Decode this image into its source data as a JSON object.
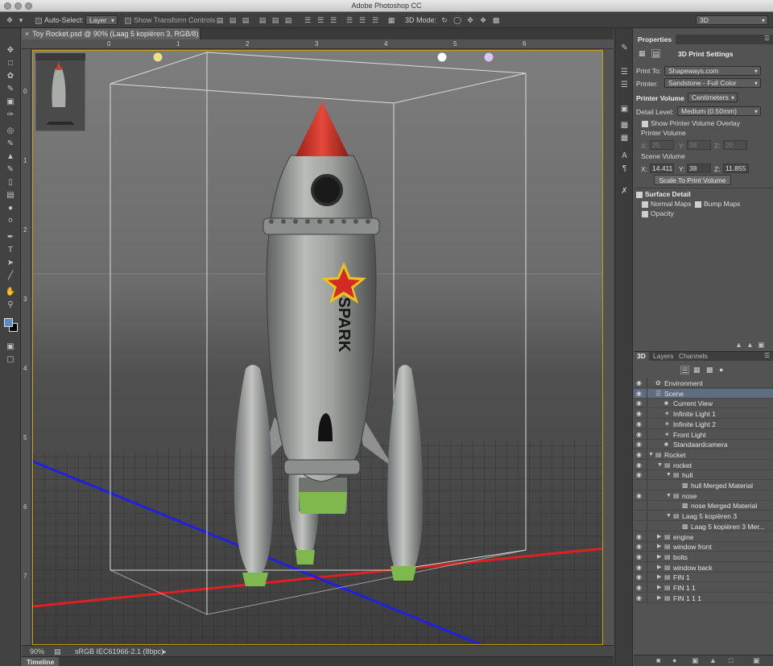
{
  "window": {
    "title": "Adobe Photoshop CC"
  },
  "options_bar": {
    "auto_select_label": "Auto-Select:",
    "auto_select_value": "Layer",
    "show_transform_label": "Show Transform Controls",
    "mode_3d_label": "3D Mode:",
    "workspace": "3D"
  },
  "document": {
    "tab_title": "Toy Rocket.psd @ 90% (Laag 5 kopiëren 3, RGB/8) *",
    "ruler_h": [
      "0",
      "1",
      "2",
      "3",
      "4",
      "5",
      "6"
    ],
    "ruler_v": [
      "0",
      "1",
      "2",
      "3",
      "4",
      "5",
      "6",
      "7"
    ],
    "rocket_label": "SPARK"
  },
  "status_bar": {
    "zoom": "90%",
    "profile": "sRGB IEC61966-2.1 (8bpc)"
  },
  "timeline": {
    "label": "Timeline"
  },
  "properties": {
    "panel_tab": "Properties",
    "section_title": "3D Print Settings",
    "print_to_label": "Print To:",
    "print_to_value": "Shapeways.com",
    "printer_label": "Printer:",
    "printer_value": "Sandstone - Full Color",
    "printer_volume_label": "Printer Volume",
    "unit_value": "Centimeters",
    "detail_level_label": "Detail Level:",
    "detail_level_value": "Medium (0.50mm)",
    "show_overlay_label": "Show Printer Volume Overlay",
    "printer_volume_sub_label": "Printer Volume",
    "printer_volume": {
      "x": "25",
      "y": "38",
      "z": "20"
    },
    "scene_volume_label": "Scene Volume",
    "scene_volume": {
      "x": "14.411",
      "y": "38",
      "z": "11.855"
    },
    "axis_labels": {
      "x": "X:",
      "y": "Y:",
      "z": "Z:"
    },
    "scale_button": "Scale To Print Volume",
    "surface_detail_label": "Surface Detail",
    "normal_maps_label": "Normal Maps",
    "bump_maps_label": "Bump Maps",
    "opacity_label": "Opacity"
  },
  "layers_panel": {
    "tabs": [
      "3D",
      "Layers",
      "Channels"
    ],
    "rows": [
      {
        "label": "Environment",
        "indent": 0,
        "icon": "environment",
        "twirl": false,
        "selected": false,
        "eye": true
      },
      {
        "label": "Scene",
        "indent": 0,
        "icon": "scene",
        "twirl": false,
        "selected": true,
        "eye": true
      },
      {
        "label": "Current View",
        "indent": 1,
        "icon": "camera",
        "twirl": false,
        "selected": false,
        "eye": true
      },
      {
        "label": "Infinite Light 1",
        "indent": 1,
        "icon": "light",
        "twirl": false,
        "selected": false,
        "eye": true
      },
      {
        "label": "Infinite Light 2",
        "indent": 1,
        "icon": "light",
        "twirl": false,
        "selected": false,
        "eye": true
      },
      {
        "label": "Front Light",
        "indent": 1,
        "icon": "light",
        "twirl": false,
        "selected": false,
        "eye": true
      },
      {
        "label": "Standaardcamera",
        "indent": 1,
        "icon": "camera",
        "twirl": false,
        "selected": false,
        "eye": true
      },
      {
        "label": "Rocket",
        "indent": 0,
        "icon": "folder",
        "twirl": "open",
        "selected": false,
        "eye": true
      },
      {
        "label": "rocket",
        "indent": 1,
        "icon": "folder",
        "twirl": "open",
        "selected": false,
        "eye": true
      },
      {
        "label": "hull",
        "indent": 2,
        "icon": "folder",
        "twirl": "open",
        "selected": false,
        "eye": true
      },
      {
        "label": "hull Merged Material",
        "indent": 3,
        "icon": "material",
        "twirl": false,
        "selected": false,
        "eye": false
      },
      {
        "label": "nose",
        "indent": 2,
        "icon": "folder",
        "twirl": "open",
        "selected": false,
        "eye": true
      },
      {
        "label": "nose Merged Material",
        "indent": 3,
        "icon": "material",
        "twirl": false,
        "selected": false,
        "eye": false
      },
      {
        "label": "Laag 5 kopiëren 3",
        "indent": 2,
        "icon": "folder",
        "twirl": "open",
        "selected": false,
        "eye": false
      },
      {
        "label": "Laag 5 kopiëren 3 Mer...",
        "indent": 3,
        "icon": "material",
        "twirl": false,
        "selected": false,
        "eye": false
      },
      {
        "label": "engine",
        "indent": 1,
        "icon": "folder",
        "twirl": "closed",
        "selected": false,
        "eye": true
      },
      {
        "label": "window front",
        "indent": 1,
        "icon": "folder",
        "twirl": "closed",
        "selected": false,
        "eye": true
      },
      {
        "label": "bolts",
        "indent": 1,
        "icon": "folder",
        "twirl": "closed",
        "selected": false,
        "eye": true
      },
      {
        "label": "window back",
        "indent": 1,
        "icon": "folder",
        "twirl": "closed",
        "selected": false,
        "eye": true
      },
      {
        "label": "FIN 1",
        "indent": 1,
        "icon": "folder",
        "twirl": "closed",
        "selected": false,
        "eye": true
      },
      {
        "label": "FIN 1 1",
        "indent": 1,
        "icon": "folder",
        "twirl": "closed",
        "selected": false,
        "eye": true
      },
      {
        "label": "FIN 1 1 1",
        "indent": 1,
        "icon": "folder",
        "twirl": "closed",
        "selected": false,
        "eye": true
      }
    ]
  },
  "colors": {
    "foreground": "#5a8cc8",
    "background": "#000000",
    "selection": "#5e6e80",
    "canvas_border": "#c9a100",
    "nose_red": "#d63a2e",
    "star_red": "#d42a26",
    "star_yellow": "#e8c41d",
    "grid_red_axis": "#e02020",
    "grid_blue_axis": "#2020e0"
  }
}
